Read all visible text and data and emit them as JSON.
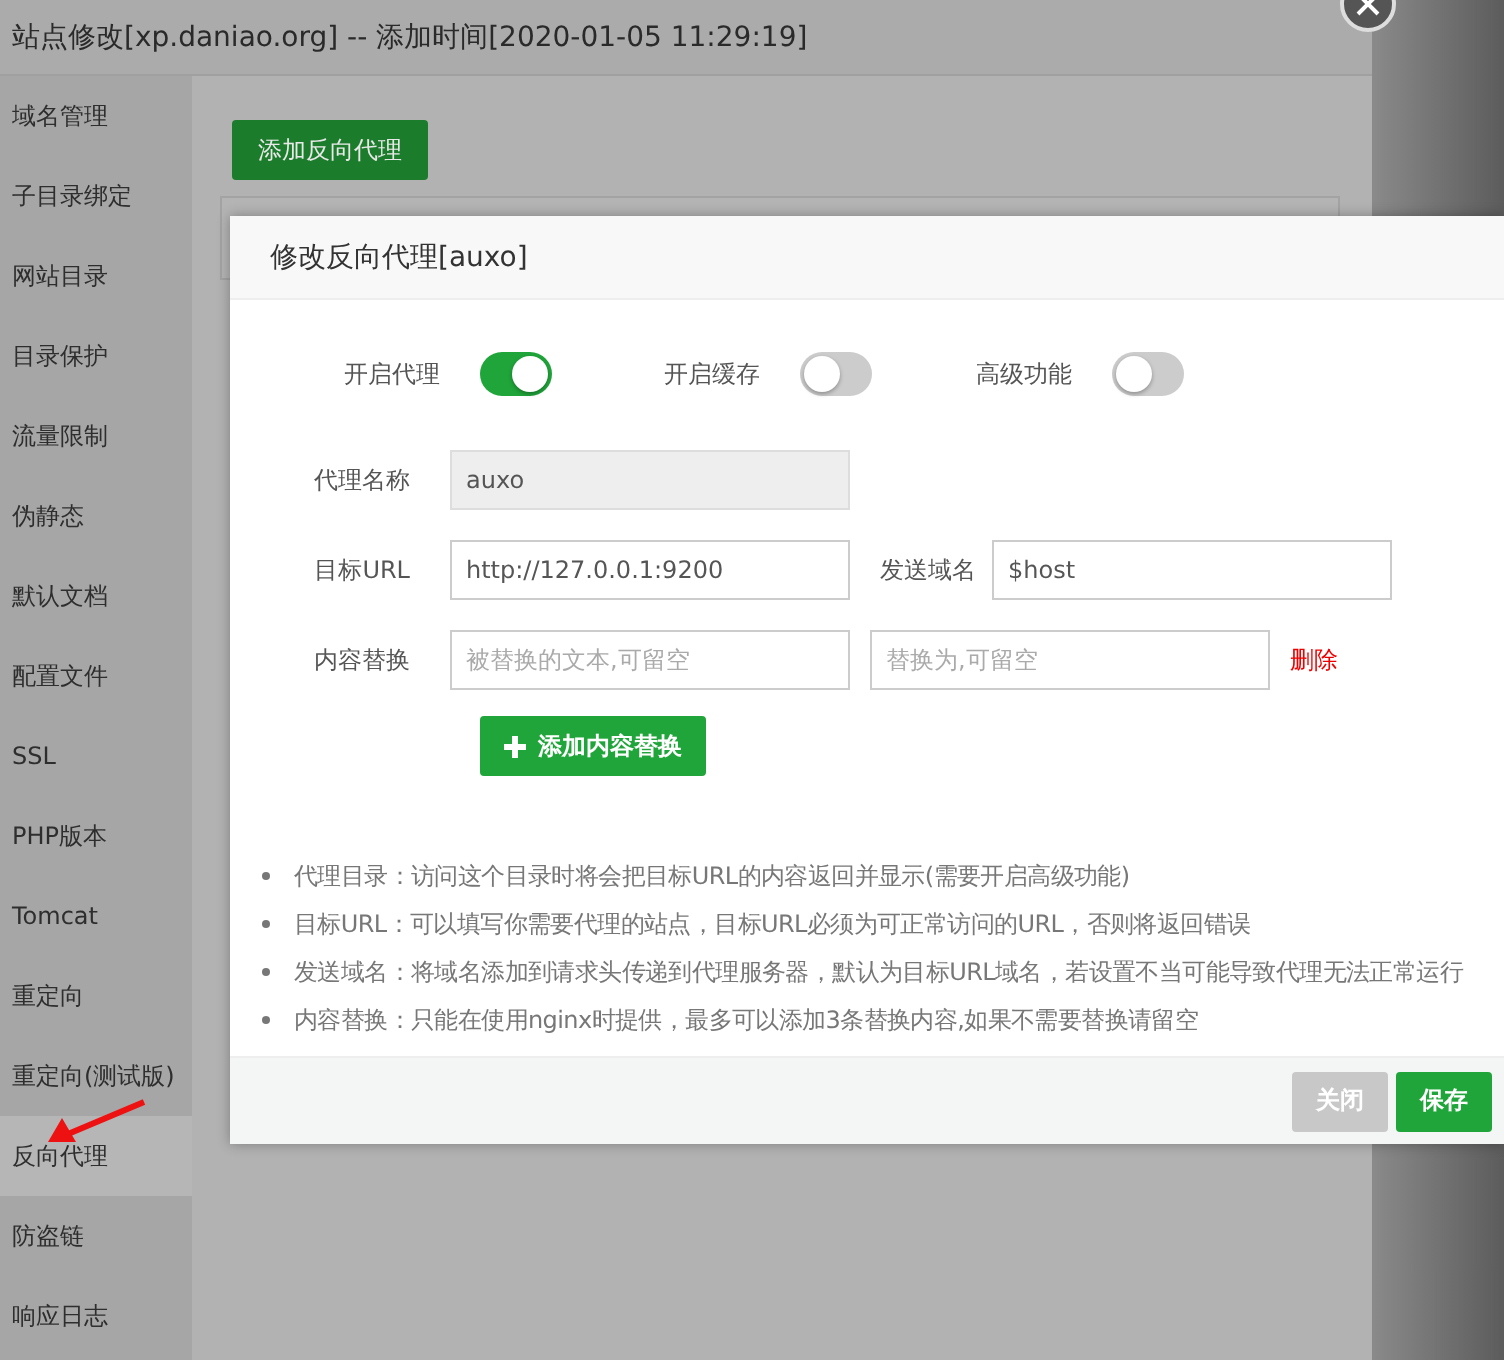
{
  "window": {
    "title": "站点修改[xp.daniao.org] -- 添加时间[2020-01-05 11:29:19]"
  },
  "sidebar": {
    "items": [
      {
        "label": "域名管理",
        "selected": false
      },
      {
        "label": "子目录绑定",
        "selected": false
      },
      {
        "label": "网站目录",
        "selected": false
      },
      {
        "label": "目录保护",
        "selected": false
      },
      {
        "label": "流量限制",
        "selected": false
      },
      {
        "label": "伪静态",
        "selected": false
      },
      {
        "label": "默认文档",
        "selected": false
      },
      {
        "label": "配置文件",
        "selected": false
      },
      {
        "label": "SSL",
        "selected": false
      },
      {
        "label": "PHP版本",
        "selected": false
      },
      {
        "label": "Tomcat",
        "selected": false
      },
      {
        "label": "重定向",
        "selected": false
      },
      {
        "label": "重定向(测试版)",
        "selected": false
      },
      {
        "label": "反向代理",
        "selected": true
      },
      {
        "label": "防盗链",
        "selected": false
      },
      {
        "label": "响应日志",
        "selected": false
      }
    ]
  },
  "main": {
    "add_button": "添加反向代理"
  },
  "dialog": {
    "title": "修改反向代理[auxo]",
    "toggles": [
      {
        "label": "开启代理",
        "on": true
      },
      {
        "label": "开启缓存",
        "on": false
      },
      {
        "label": "高级功能",
        "on": false
      }
    ],
    "form_rows": [
      {
        "label": "代理名称",
        "items": [
          {
            "kind": "input",
            "value": "auxo",
            "disabled": true
          }
        ]
      },
      {
        "label": "目标URL",
        "items": [
          {
            "kind": "input",
            "value": "http://127.0.0.1:9200",
            "disabled": false
          },
          {
            "kind": "label",
            "text": "发送域名"
          },
          {
            "kind": "input",
            "value": "$host",
            "disabled": false
          }
        ]
      },
      {
        "label": "内容替换",
        "items": [
          {
            "kind": "input",
            "placeholder": "被替换的文本,可留空",
            "disabled": false
          },
          {
            "kind": "input",
            "placeholder": "替换为,可留空",
            "disabled": false
          },
          {
            "kind": "link",
            "text": "删除"
          }
        ]
      }
    ],
    "add_replace_button": "添加内容替换",
    "notes": [
      "代理目录：访问这个目录时将会把目标URL的内容返回并显示(需要开启高级功能)",
      "目标URL：可以填写你需要代理的站点，目标URL必须为可正常访问的URL，否则将返回错误",
      "发送域名：将域名添加到请求头传递到代理服务器，默认为目标URL域名，若设置不当可能导致代理无法正常运行",
      "内容替换：只能在使用nginx时提供，最多可以添加3条替换内容,如果不需要替换请留空"
    ],
    "buttons": [
      {
        "label": "关闭",
        "kind": "cancel"
      },
      {
        "label": "保存",
        "kind": "primary"
      }
    ]
  }
}
